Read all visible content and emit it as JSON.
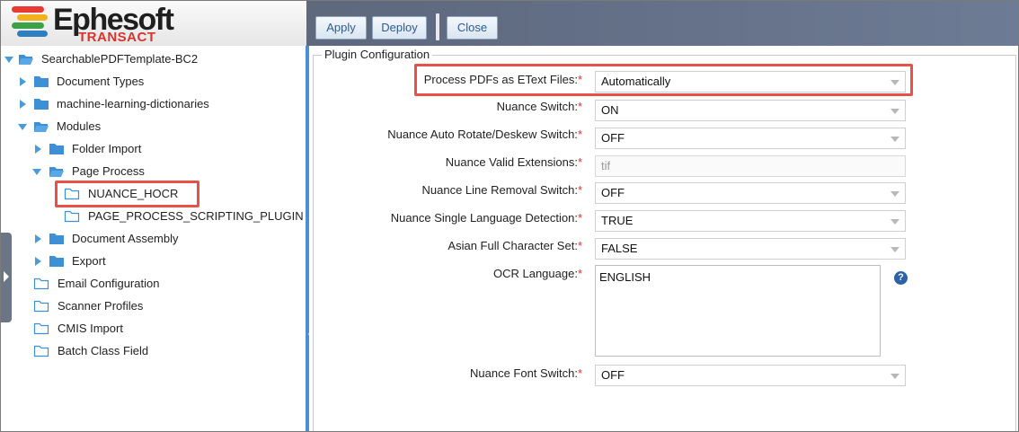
{
  "app": {
    "logo_word": "Ephesoft",
    "logo_sub": "TRANSACT",
    "logo_colors": [
      "#e63a33",
      "#f2b21e",
      "#3da14a",
      "#2e7fc1"
    ]
  },
  "toolbar": {
    "apply_label": "Apply",
    "deploy_label": "Deploy",
    "close_label": "Close"
  },
  "tree": {
    "root": "SearchablePDFTemplate-BC2",
    "document_types": "Document Types",
    "ml_dictionaries": "machine-learning-dictionaries",
    "modules": "Modules",
    "folder_import": "Folder Import",
    "page_process": "Page Process",
    "nuance_hocr": "NUANCE_HOCR",
    "page_process_scripting": "PAGE_PROCESS_SCRIPTING_PLUGIN",
    "document_assembly": "Document Assembly",
    "export": "Export",
    "email_configuration": "Email Configuration",
    "scanner_profiles": "Scanner Profiles",
    "cmis_import": "CMIS Import",
    "batch_class_field": "Batch Class Field"
  },
  "config": {
    "legend": "Plugin Configuration",
    "fields": {
      "process_pdfs": {
        "label": "Process PDFs as EText Files:",
        "value": "Automatically"
      },
      "nuance_switch": {
        "label": "Nuance Switch:",
        "value": "ON"
      },
      "auto_rotate": {
        "label": "Nuance Auto Rotate/Deskew Switch:",
        "value": "OFF"
      },
      "valid_extensions": {
        "label": "Nuance Valid Extensions:",
        "value": "tif"
      },
      "line_removal": {
        "label": "Nuance Line Removal Switch:",
        "value": "OFF"
      },
      "single_language": {
        "label": "Nuance Single Language Detection:",
        "value": "TRUE"
      },
      "asian_full_char": {
        "label": "Asian Full Character Set:",
        "value": "FALSE"
      },
      "ocr_language": {
        "label": "OCR Language:",
        "value": "ENGLISH"
      },
      "font_switch": {
        "label": "Nuance Font Switch:",
        "value": "OFF"
      }
    },
    "required_mark": "*",
    "help_glyph": "?"
  },
  "colors": {
    "highlight": "#e8514a",
    "accent_blue": "#4a8fd1",
    "button_text": "#2f5c8f"
  }
}
